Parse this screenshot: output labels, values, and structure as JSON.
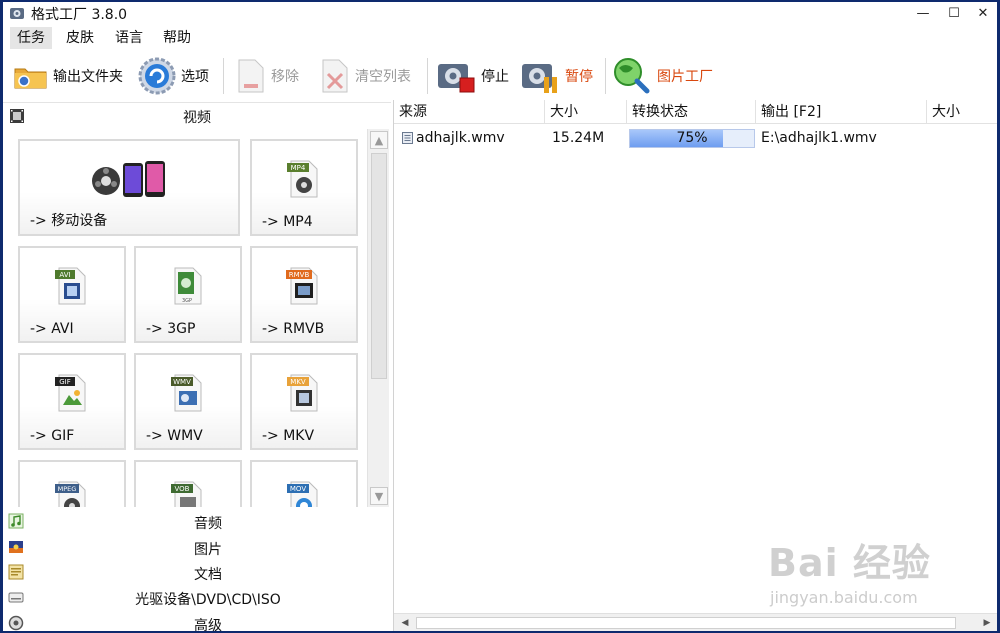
{
  "window": {
    "title": "格式工厂 3.8.0",
    "controls": {
      "minimize": "—",
      "maximize": "☐",
      "close": "✕"
    }
  },
  "menu": {
    "items": [
      "任务",
      "皮肤",
      "语言",
      "帮助"
    ],
    "active": "任务"
  },
  "toolbar": {
    "output_folder": "输出文件夹",
    "options": "选项",
    "remove": "移除",
    "clear_list": "清空列表",
    "stop": "停止",
    "pause": "暂停",
    "picture_factory": "图片工厂",
    "pause_color": "#d9480f",
    "picture_factory_color": "#d9480f"
  },
  "left_panel": {
    "video_header": "视频",
    "tiles": [
      {
        "label": "-> 移动设备",
        "icon": "mobile-devices-icon"
      },
      {
        "label": "-> MP4",
        "icon": "mp4-file-icon",
        "badge": "MP4"
      },
      {
        "label": "-> AVI",
        "icon": "avi-file-icon",
        "badge": "AVI"
      },
      {
        "label": "-> 3GP",
        "icon": "3gp-file-icon",
        "badge": "3GP"
      },
      {
        "label": "-> RMVB",
        "icon": "rmvb-file-icon",
        "badge": "RMVB"
      },
      {
        "label": "-> GIF",
        "icon": "gif-file-icon",
        "badge": "GIF"
      },
      {
        "label": "-> WMV",
        "icon": "wmv-file-icon",
        "badge": "WMV"
      },
      {
        "label": "-> MKV",
        "icon": "mkv-file-icon",
        "badge": "MKV"
      },
      {
        "label": "",
        "icon": "mpeg-file-icon",
        "badge": "MPEG"
      },
      {
        "label": "",
        "icon": "vob-file-icon",
        "badge": "VOB"
      },
      {
        "label": "",
        "icon": "mov-file-icon",
        "badge": "MOV"
      }
    ],
    "categories": [
      "音频",
      "图片",
      "文档",
      "光驱设备\\DVD\\CD\\ISO",
      "高级"
    ]
  },
  "task_list": {
    "columns": [
      "来源",
      "大小",
      "转换状态",
      "输出 [F2]",
      "大小"
    ],
    "rows": [
      {
        "source": "adhajlk.wmv",
        "size": "15.24M",
        "status": "75%",
        "progress": 0.75,
        "output": "E:\\adhajlk1.wmv",
        "out_size": ""
      }
    ]
  },
  "watermark": {
    "brand": "Bai 经验",
    "url": "jingyan.baidu.com"
  }
}
